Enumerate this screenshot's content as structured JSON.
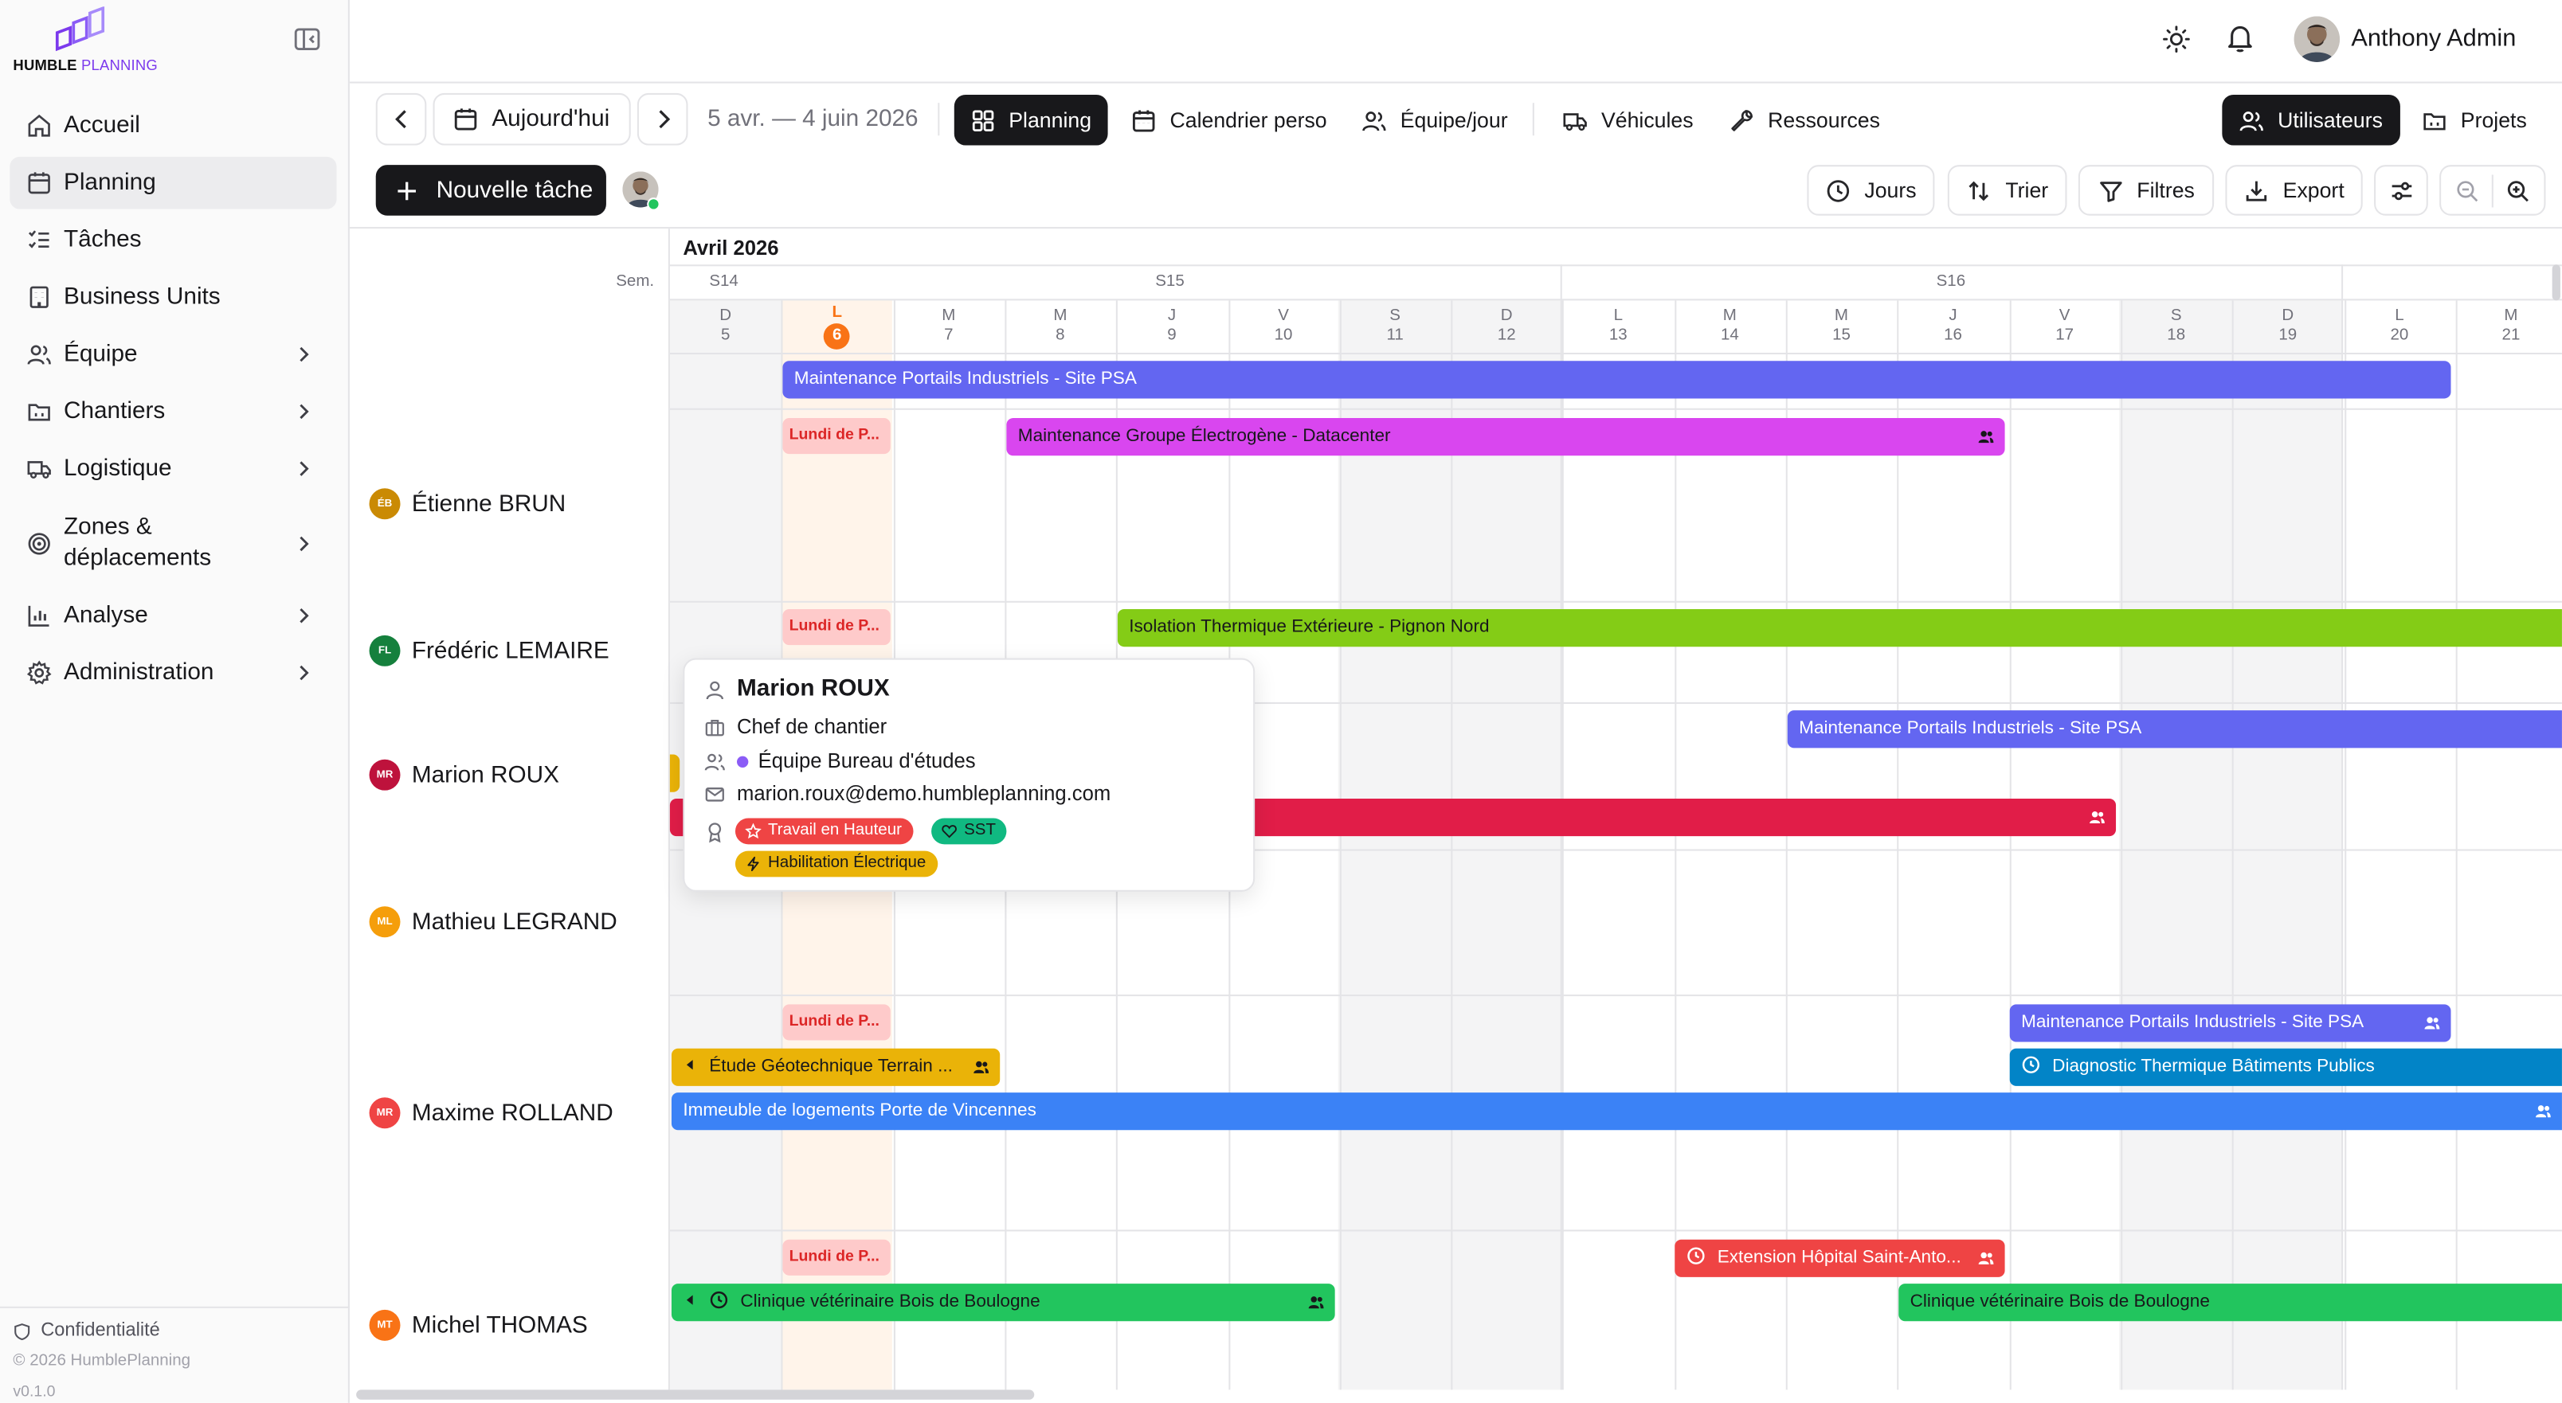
{
  "app": {
    "logo_word1": "HUMBLE",
    "logo_word2": "PLANNING",
    "brand_color": "#7c3aed"
  },
  "sidebar": {
    "items": [
      {
        "label": "Accueil",
        "icon": "home-icon"
      },
      {
        "label": "Planning",
        "icon": "calendar-icon",
        "active": true
      },
      {
        "label": "Tâches",
        "icon": "tasks-icon"
      },
      {
        "label": "Business Units",
        "icon": "building-icon"
      },
      {
        "label": "Équipe",
        "icon": "users-icon",
        "has_children": true
      },
      {
        "label": "Chantiers",
        "icon": "folder-icon",
        "has_children": true
      },
      {
        "label": "Logistique",
        "icon": "truck-icon",
        "has_children": true
      },
      {
        "label": "Zones & déplacements",
        "icon": "target-icon",
        "has_children": true
      },
      {
        "label": "Analyse",
        "icon": "chart-icon",
        "has_children": true
      },
      {
        "label": "Administration",
        "icon": "gear-icon",
        "has_children": true
      }
    ],
    "privacy_label": "Confidentialité",
    "copyright": "© 2026 HumblePlanning",
    "version": "v0.1.0"
  },
  "header": {
    "user_name": "Anthony Admin"
  },
  "toolbar": {
    "today_label": "Aujourd'hui",
    "date_range": "5 avr. — 4 juin 2026",
    "tabs": [
      {
        "label": "Planning",
        "active": true
      },
      {
        "label": "Calendrier perso"
      },
      {
        "label": "Équipe/jour"
      },
      {
        "label": "Véhicules"
      },
      {
        "label": "Ressources"
      }
    ],
    "view_users": "Utilisateurs",
    "view_projects": "Projets",
    "new_task": "Nouvelle tâche",
    "days": "Jours",
    "sort": "Trier",
    "filters": "Filtres",
    "export": "Export"
  },
  "calendar": {
    "month": "Avril 2026",
    "week_header": "Sem.",
    "weeks": [
      "S14",
      "S15",
      "S16"
    ],
    "days": [
      {
        "letter": "D",
        "num": "5"
      },
      {
        "letter": "L",
        "num": "6",
        "today": true
      },
      {
        "letter": "M",
        "num": "7"
      },
      {
        "letter": "M",
        "num": "8"
      },
      {
        "letter": "J",
        "num": "9"
      },
      {
        "letter": "V",
        "num": "10"
      },
      {
        "letter": "S",
        "num": "11"
      },
      {
        "letter": "D",
        "num": "12"
      },
      {
        "letter": "L",
        "num": "13"
      },
      {
        "letter": "M",
        "num": "14"
      },
      {
        "letter": "M",
        "num": "15"
      },
      {
        "letter": "J",
        "num": "16"
      },
      {
        "letter": "V",
        "num": "17"
      },
      {
        "letter": "S",
        "num": "18"
      },
      {
        "letter": "D",
        "num": "19"
      },
      {
        "letter": "L",
        "num": "20"
      },
      {
        "letter": "M",
        "num": "21"
      }
    ],
    "holiday_label": "Lundi de P...",
    "unassigned_task": "Maintenance Portails Industriels - Site PSA",
    "people": [
      {
        "initials": "ÉB",
        "name": "Étienne BRUN",
        "color": "#ca8a04"
      },
      {
        "initials": "FL",
        "name": "Frédéric LEMAIRE",
        "color": "#15803d"
      },
      {
        "initials": "MR",
        "name": "Marion ROUX",
        "color": "#be123c"
      },
      {
        "initials": "ML",
        "name": "Mathieu LEGRAND",
        "color": "#f59e0b"
      },
      {
        "initials": "MR",
        "name": "Maxime ROLLAND",
        "color": "#ef4444"
      },
      {
        "initials": "MT",
        "name": "Michel THOMAS",
        "color": "#f97316"
      }
    ],
    "tasks": {
      "generator": "Maintenance Groupe Électrogène - Datacenter",
      "insulation": "Isolation Thermique Extérieure - Pignon Nord",
      "portails_roux": "Maintenance Portails Industriels - Site PSA",
      "portails_rolland": "Maintenance Portails Industriels - Site PSA",
      "geotech": "Étude Géotechnique Terrain ...",
      "diagnostic": "Diagnostic Thermique Bâtiments Publics",
      "immeuble": "Immeuble de logements Porte de Vincennes",
      "hopital": "Extension Hôpital Saint-Anto...",
      "clinique1": "Clinique vétérinaire Bois de Boulogne",
      "clinique2": "Clinique vétérinaire Bois de Boulogne"
    },
    "colors": {
      "indigo": "#6366f1",
      "magenta": "#d946ef",
      "lime": "#84cc16",
      "crimson": "#e11d48",
      "amber": "#eab308",
      "sky": "#0284c7",
      "blue": "#3b82f6",
      "red": "#ef4444",
      "green": "#22c55e"
    }
  },
  "popup": {
    "name": "Marion ROUX",
    "role": "Chef de chantier",
    "team": "Équipe Bureau d'études",
    "email": "marion.roux@demo.humbleplanning.com",
    "badges": [
      {
        "label": "Travail en Hauteur",
        "color": "#ef4444"
      },
      {
        "label": "SST",
        "color": "#10b981"
      },
      {
        "label": "Habilitation Électrique",
        "color": "#eab308"
      }
    ]
  }
}
